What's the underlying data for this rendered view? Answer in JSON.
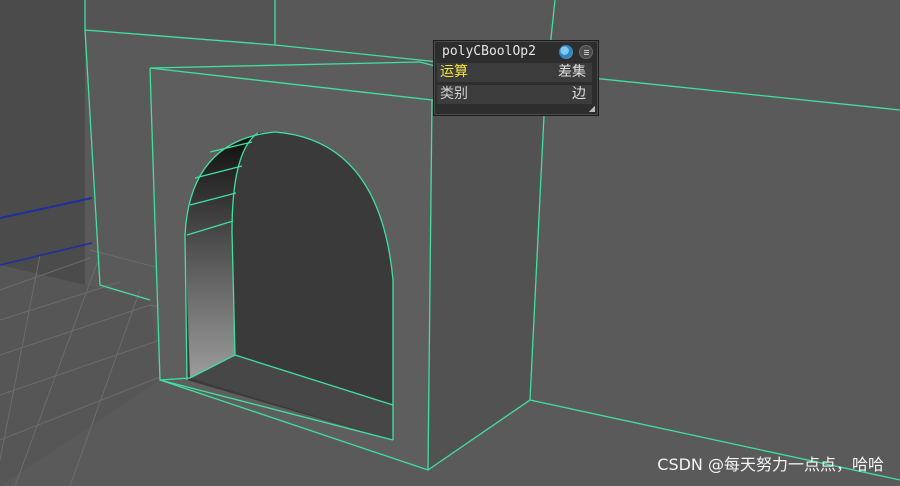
{
  "node_editor": {
    "title": "polyCBoolOp2",
    "rows": [
      {
        "label": "运算",
        "value": "差集"
      },
      {
        "label": "类别",
        "value": "边"
      }
    ],
    "icons": [
      "render-globe-icon",
      "menu-icon",
      "resize-grip-icon"
    ]
  },
  "watermark": "CSDN @每天努力一点点，哈哈",
  "colors": {
    "viewport_bg": "#5a5a5a",
    "wireframe_highlight": "#40e0a0",
    "grid_line": "#6e6e6e",
    "axis_line": "#1e2fa0",
    "label_highlight": "#f2e43a"
  }
}
